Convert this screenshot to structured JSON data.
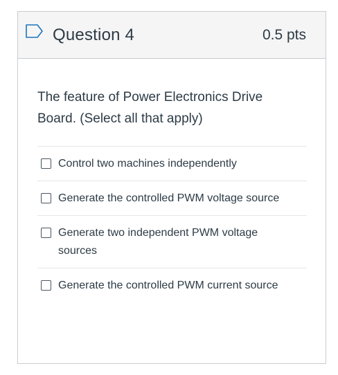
{
  "question": {
    "title": "Question 4",
    "points": "0.5 pts",
    "flag_icon": "bookmark-flag-icon",
    "text": "The feature of  Power Electronics Drive Board. (Select all that apply)"
  },
  "answers": [
    {
      "label": "Control two machines independently",
      "checked": false
    },
    {
      "label": "Generate the controlled PWM voltage source",
      "checked": false
    },
    {
      "label": "Generate two independent PWM voltage sources",
      "checked": false
    },
    {
      "label": "Generate the controlled PWM current source",
      "checked": false
    }
  ],
  "colors": {
    "header_bg": "#f5f5f5",
    "border": "#c7cdd1",
    "text": "#2d3b45",
    "flag": "#1b75bb"
  }
}
